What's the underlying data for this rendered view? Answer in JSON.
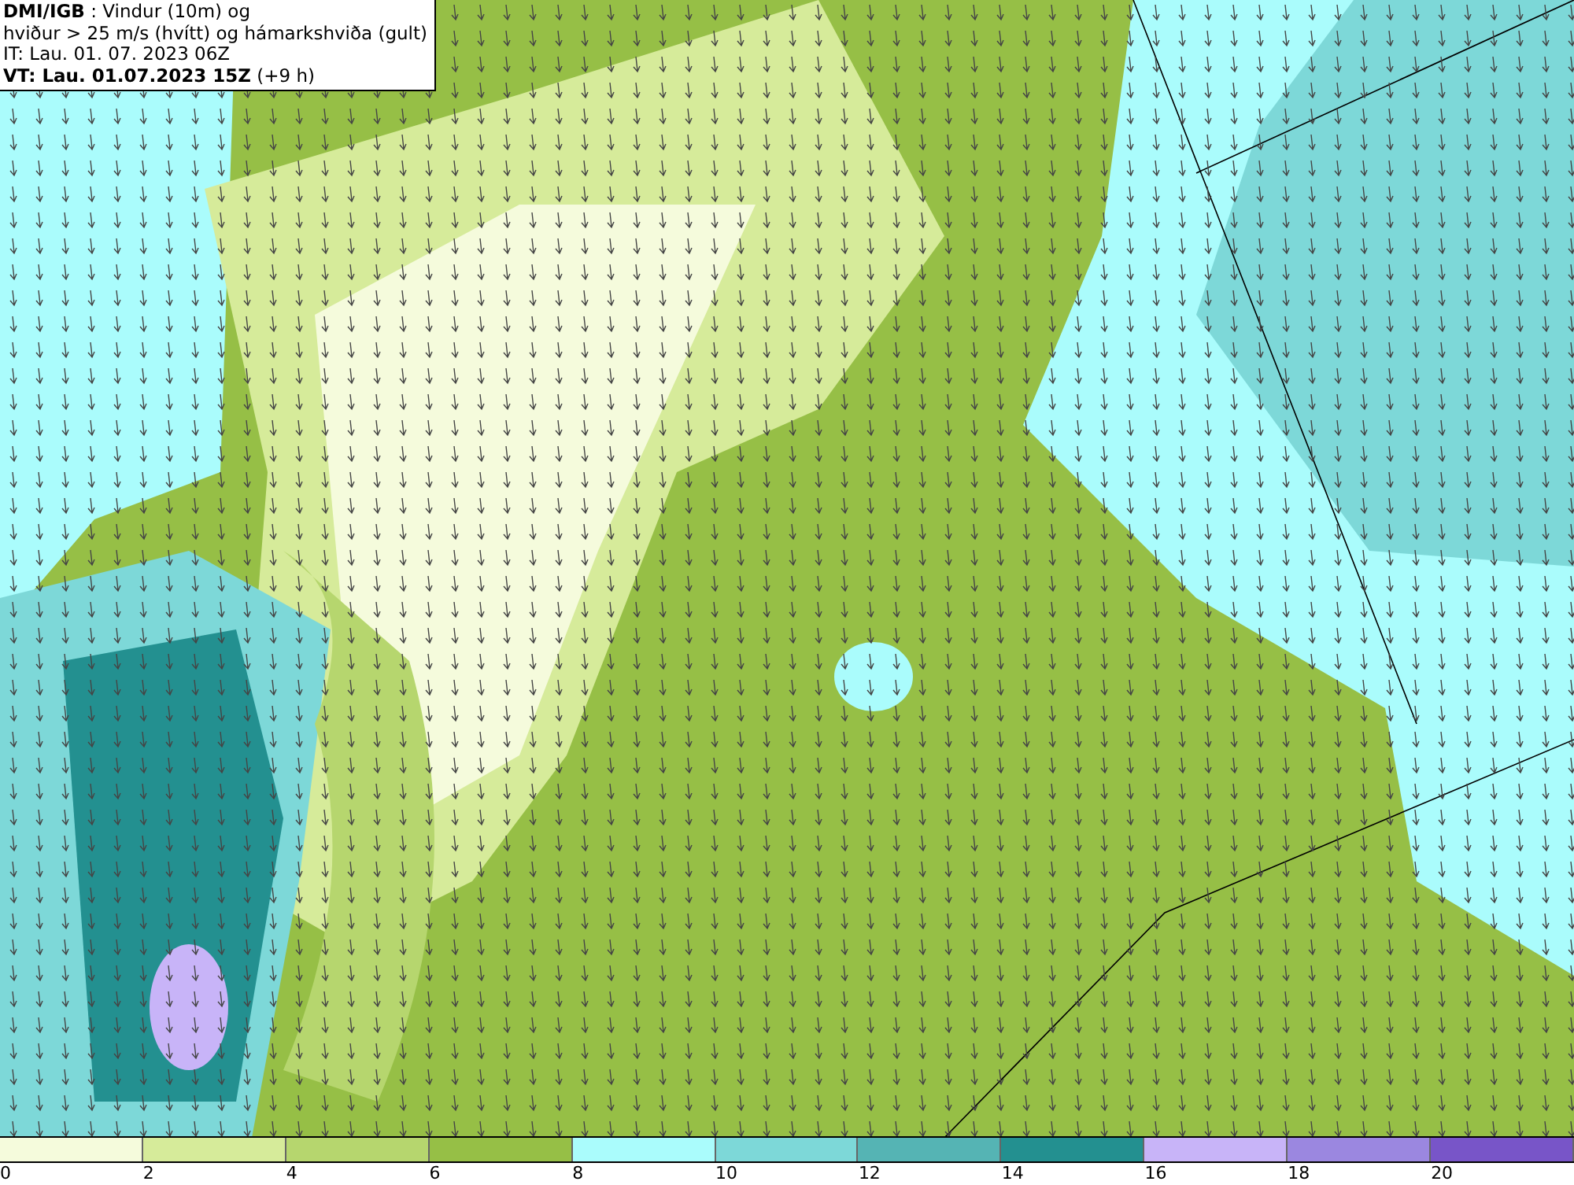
{
  "header": {
    "lines": [
      "**DMI/IGB** : Vindur (10m) og",
      "hviður > 25 m/s (hvítt) og hámarkshviða (gult)",
      "IT: Lau. 01. 07. 2023 06Z",
      "**VT: Lau. 01.07.2023 15Z** (+9 h)"
    ]
  },
  "legend": [
    {
      "label": "0",
      "color": "#f5fbdc"
    },
    {
      "label": "2",
      "color": "#d6eb9a"
    },
    {
      "label": "4",
      "color": "#b6d66e"
    },
    {
      "label": "6",
      "color": "#96bf46"
    },
    {
      "label": "8",
      "color": "#aafcfc"
    },
    {
      "label": "10",
      "color": "#7dd8d8"
    },
    {
      "label": "12",
      "color": "#55b4b4"
    },
    {
      "label": "14",
      "color": "#239090"
    },
    {
      "label": "16",
      "color": "#c8b4f8"
    },
    {
      "label": "18",
      "color": "#9b87e0"
    },
    {
      "label": "20",
      "color": "#7855c8"
    }
  ]
}
